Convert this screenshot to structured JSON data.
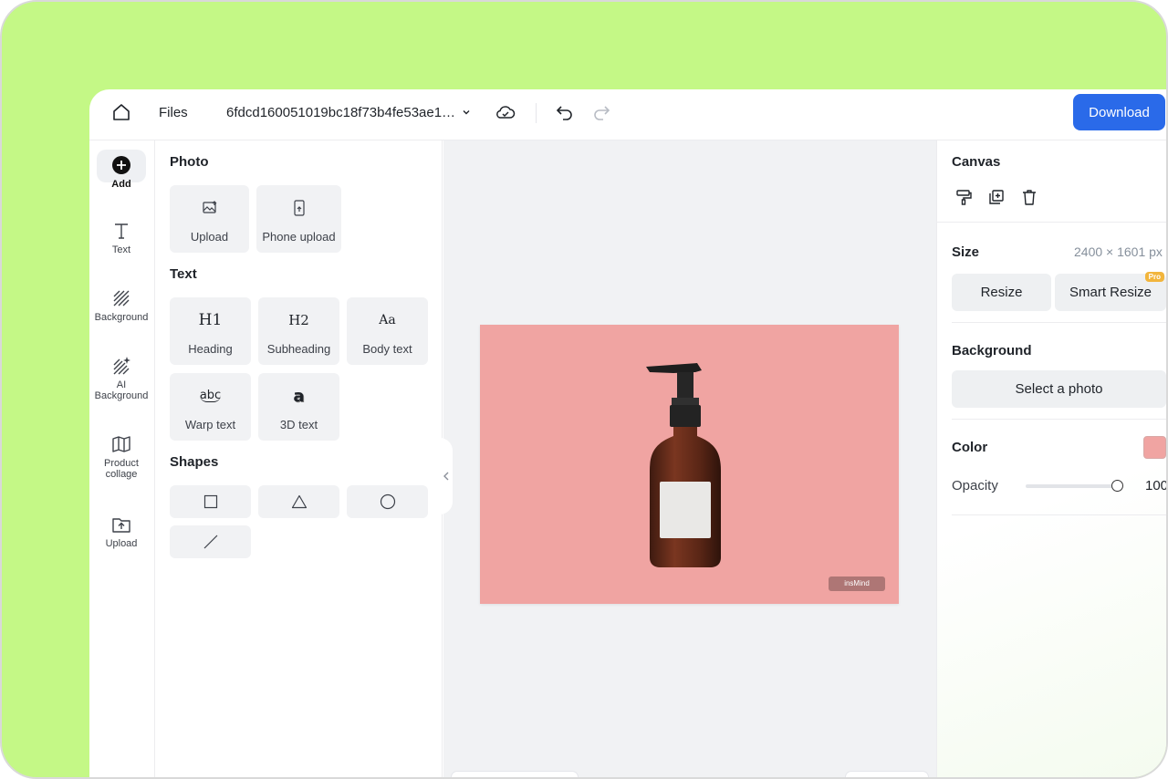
{
  "header": {
    "files_label": "Files",
    "file_name": "6fdcd160051019bc18f73b4fe53ae1…",
    "download_label": "Download"
  },
  "rail": {
    "items": [
      {
        "label": "Add",
        "icon": "plus-circle-icon"
      },
      {
        "label": "Text",
        "icon": "text-t-icon"
      },
      {
        "label": "Background",
        "icon": "hatch-icon"
      },
      {
        "label": "AI",
        "label2": "Background",
        "icon": "ai-hatch-icon"
      },
      {
        "label": "Product",
        "label2": "collage",
        "icon": "map-fold-icon"
      },
      {
        "label": "Upload",
        "icon": "folder-upload-icon"
      }
    ]
  },
  "panel": {
    "photo": {
      "title": "Photo",
      "items": [
        {
          "label": "Upload",
          "icon": "image-upload-icon"
        },
        {
          "label": "Phone upload",
          "icon": "phone-upload-icon"
        }
      ]
    },
    "text": {
      "title": "Text",
      "items": [
        {
          "label": "Heading",
          "glyph": "H1"
        },
        {
          "label": "Subheading",
          "glyph": "H2"
        },
        {
          "label": "Body text",
          "glyph": "Aa"
        },
        {
          "label": "Warp text",
          "glyph": "abc"
        },
        {
          "label": "3D text",
          "glyph": "a"
        }
      ]
    },
    "shapes": {
      "title": "Shapes",
      "items": [
        "square-icon",
        "triangle-icon",
        "circle-icon",
        "line-icon"
      ]
    }
  },
  "canvas": {
    "background_color": "#f0a4a2",
    "watermark": "insMind"
  },
  "right": {
    "canvas_title": "Canvas",
    "tools": [
      "paint-roller-icon",
      "duplicate-icon",
      "trash-icon"
    ],
    "size_title": "Size",
    "size_value": "2400 × 1601 px",
    "resize_label": "Resize",
    "smart_resize_label": "Smart Resize",
    "pro_badge": "Pro",
    "background_title": "Background",
    "select_photo_label": "Select a photo",
    "color_title": "Color",
    "color_value": "#f0a4a2",
    "opacity_label": "Opacity",
    "opacity_value": "100"
  },
  "colors": {
    "accent": "#2a6ae9",
    "frame": "#c4f886"
  }
}
